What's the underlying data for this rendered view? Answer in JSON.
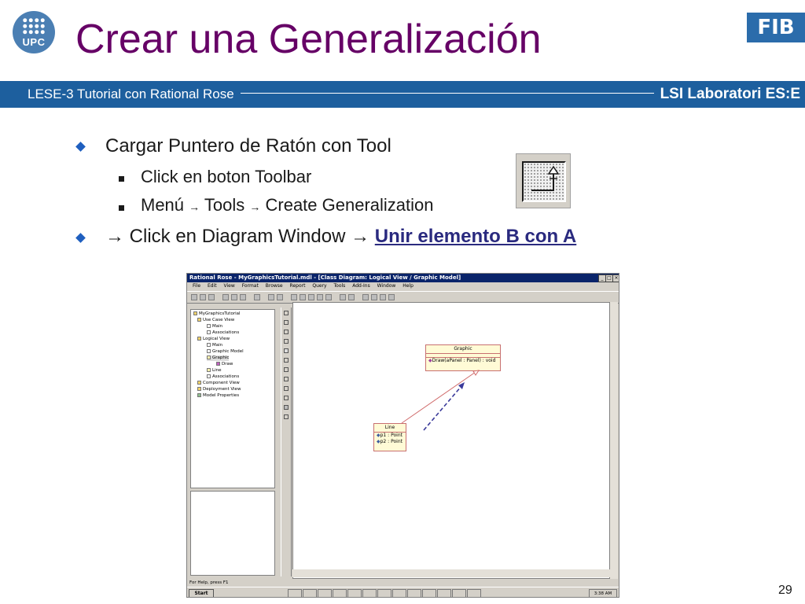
{
  "header": {
    "upc_logo_text": "UPC",
    "title": "Crear una Generalización",
    "fib_logo_text": "FIB",
    "band_left": "LESE-3 Tutorial con Rational Rose",
    "band_right": "LSI Laboratori ES:E"
  },
  "bullets": [
    {
      "text": "Cargar Puntero de Ratón con Tool"
    },
    {
      "text": "Click en boton Toolbar"
    },
    {
      "text": "Menú",
      "arrow1": "→",
      "part2": "Tools",
      "arrow2": "→",
      "part3": "Create Generalization"
    },
    {
      "arrow_a": "→",
      "part1": "Click en Diagram Window",
      "arrow_b": "→",
      "link": "Unir elemento B con A"
    }
  ],
  "rose_window": {
    "title": "Rational Rose - MyGraphicsTutorial.mdl - [Class Diagram: Logical View / Graphic Model]",
    "menus": [
      "File",
      "Edit",
      "View",
      "Format",
      "Browse",
      "Report",
      "Query",
      "Tools",
      "Add-Ins",
      "Window",
      "Help"
    ],
    "tree": [
      {
        "label": "MyGraphicsTutorial",
        "level": 0
      },
      {
        "label": "Use Case View",
        "level": 1
      },
      {
        "label": "Main",
        "level": 2
      },
      {
        "label": "Associations",
        "level": 2
      },
      {
        "label": "Logical View",
        "level": 1
      },
      {
        "label": "Main",
        "level": 2
      },
      {
        "label": "Graphic Model",
        "level": 2
      },
      {
        "label": "Graphic",
        "level": 2
      },
      {
        "label": "Draw",
        "level": 3
      },
      {
        "label": "Line",
        "level": 2
      },
      {
        "label": "Associations",
        "level": 2
      },
      {
        "label": "Component View",
        "level": 1
      },
      {
        "label": "Deployment View",
        "level": 1
      },
      {
        "label": "Model Properties",
        "level": 1
      }
    ],
    "palette_icons": [
      "arrow-icon",
      "text-icon",
      "note-icon",
      "anchor-icon",
      "class-icon",
      "interface-icon",
      "association-icon",
      "aggregation-icon",
      "package-icon",
      "dependency-icon",
      "generalization-icon",
      "realize-icon"
    ],
    "class_graphic": {
      "name": "Graphic",
      "operation": "Draw(aPanel : Panel) : void"
    },
    "class_line": {
      "name": "Line",
      "attributes": [
        "p1 : Point",
        "p2 : Point"
      ]
    },
    "status": "For Help, press F1",
    "taskbar": {
      "start": "Start",
      "clock": "3:38 AM"
    }
  },
  "page_number": "29",
  "colors": {
    "title": "#660066",
    "band": "#1d5f9e",
    "bullet_diamond": "#1f5fbf",
    "link": "#2a2a7f"
  }
}
